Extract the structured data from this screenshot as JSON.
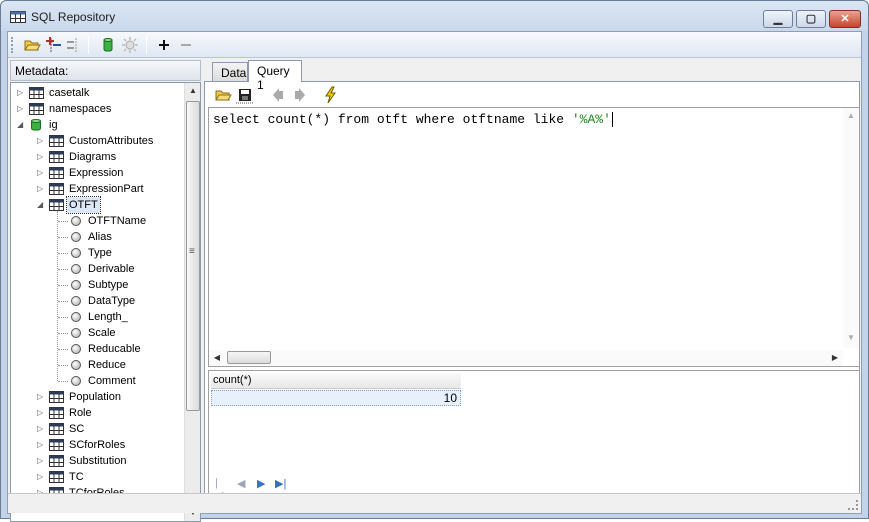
{
  "window": {
    "title": "SQL Repository"
  },
  "metadata": {
    "header": "Metadata:",
    "tree": {
      "roots": [
        "casetalk",
        "namespaces"
      ],
      "ig": "ig",
      "ig_children_before": [
        "CustomAttributes",
        "Diagrams",
        "Expression",
        "ExpressionPart"
      ],
      "selected_table": "OTFT",
      "columns": [
        "OTFTName",
        "Alias",
        "Type",
        "Derivable",
        "Subtype",
        "DataType",
        "Length_",
        "Scale",
        "Reducable",
        "Reduce",
        "Comment"
      ],
      "ig_children_after": [
        "Population",
        "Role",
        "SC",
        "SCforRoles",
        "Substitution",
        "TC",
        "TCforRoles"
      ]
    }
  },
  "tabs": [
    {
      "label": "Data"
    },
    {
      "label": "Query 1"
    }
  ],
  "query": {
    "sql_prefix": "select count(*) from otft where otftname like ",
    "sql_string": "'%A%'"
  },
  "results": {
    "column_header": "count(*)",
    "value": "10"
  },
  "icons": {
    "toolbar": [
      "open-folder-icon",
      "add-connection-icon",
      "remove-connection-icon",
      "database-icon",
      "settings-icon",
      "plus-icon",
      "minus-icon"
    ],
    "query_toolbar": [
      "open-folder-icon",
      "save-icon",
      "back-arrow-icon",
      "forward-arrow-icon",
      "execute-lightning-icon"
    ]
  },
  "colors": {
    "string_literal": "#1a8a1a",
    "selection": "#dde8f6"
  }
}
